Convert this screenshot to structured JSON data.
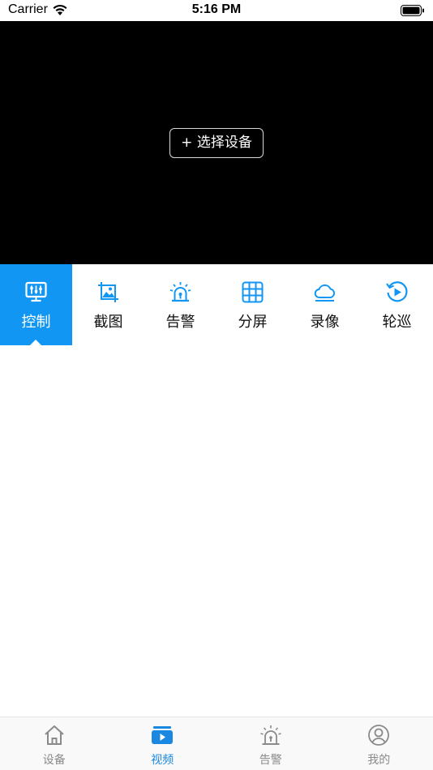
{
  "status_bar": {
    "carrier": "Carrier",
    "time": "5:16 PM"
  },
  "video": {
    "select_device_label": "+ 选择设备"
  },
  "toolbar": {
    "accent_color": "#1296f3",
    "items": [
      {
        "label": "控制",
        "icon": "control-panel-icon",
        "active": true
      },
      {
        "label": "截图",
        "icon": "screenshot-icon"
      },
      {
        "label": "告警",
        "icon": "alarm-icon"
      },
      {
        "label": "分屏",
        "icon": "grid-icon"
      },
      {
        "label": "录像",
        "icon": "cloud-icon"
      },
      {
        "label": "轮巡",
        "icon": "patrol-play-icon"
      }
    ]
  },
  "tab_bar": {
    "active_color": "#1a88e0",
    "items": [
      {
        "label": "设备",
        "icon": "home-icon"
      },
      {
        "label": "视频",
        "icon": "video-icon",
        "active": true
      },
      {
        "label": "告警",
        "icon": "alarm-icon"
      },
      {
        "label": "我的",
        "icon": "user-icon"
      }
    ]
  }
}
